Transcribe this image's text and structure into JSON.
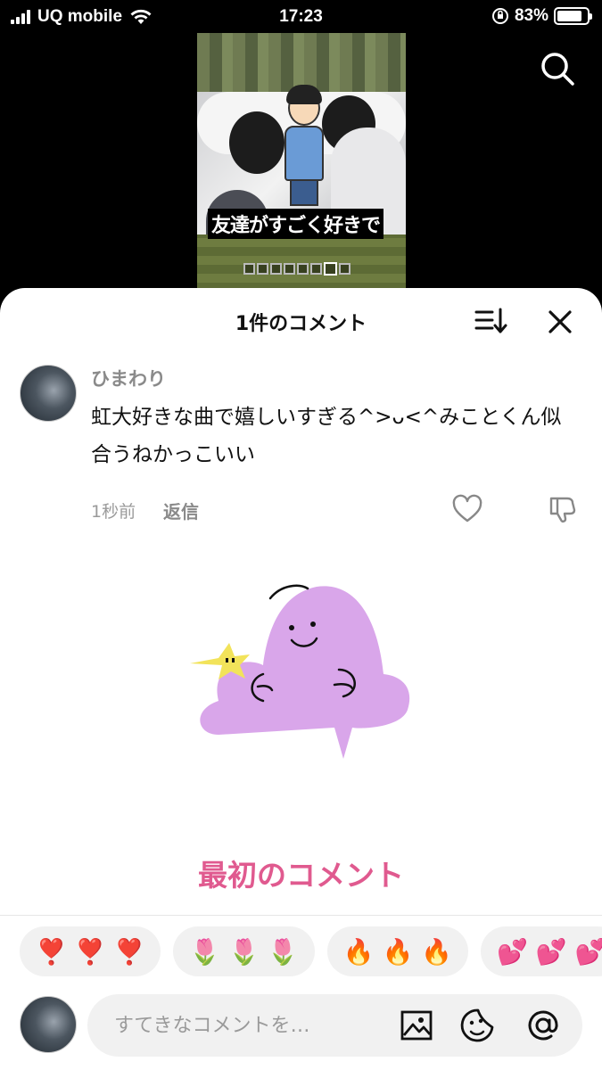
{
  "status_bar": {
    "carrier": "UQ mobile",
    "time": "17:23",
    "battery": "83%",
    "battery_level": 0.83
  },
  "video": {
    "caption": "友達がすごく好きで"
  },
  "sheet": {
    "title": "1件のコメント",
    "comment": {
      "username": "ひまわり",
      "text": "虹大好きな曲で嬉しいすぎる^>ᴗ<^みことくん似合うねかっこいい",
      "time": "1秒前",
      "reply_label": "返信"
    },
    "first_comment_label": "最初のコメント",
    "reactions": [
      {
        "emojis": "❣️ ❣️ ❣️"
      },
      {
        "emojis": "🌷 🌷 🌷"
      },
      {
        "emojis": "🔥 🔥 🔥"
      },
      {
        "emojis": "💕 💕 💕"
      }
    ],
    "input_placeholder": "すてきなコメントを…"
  },
  "colors": {
    "accent_pink": "#e05a8f",
    "blob_purple": "#d9a6ea",
    "star_yellow": "#f2e35a"
  }
}
